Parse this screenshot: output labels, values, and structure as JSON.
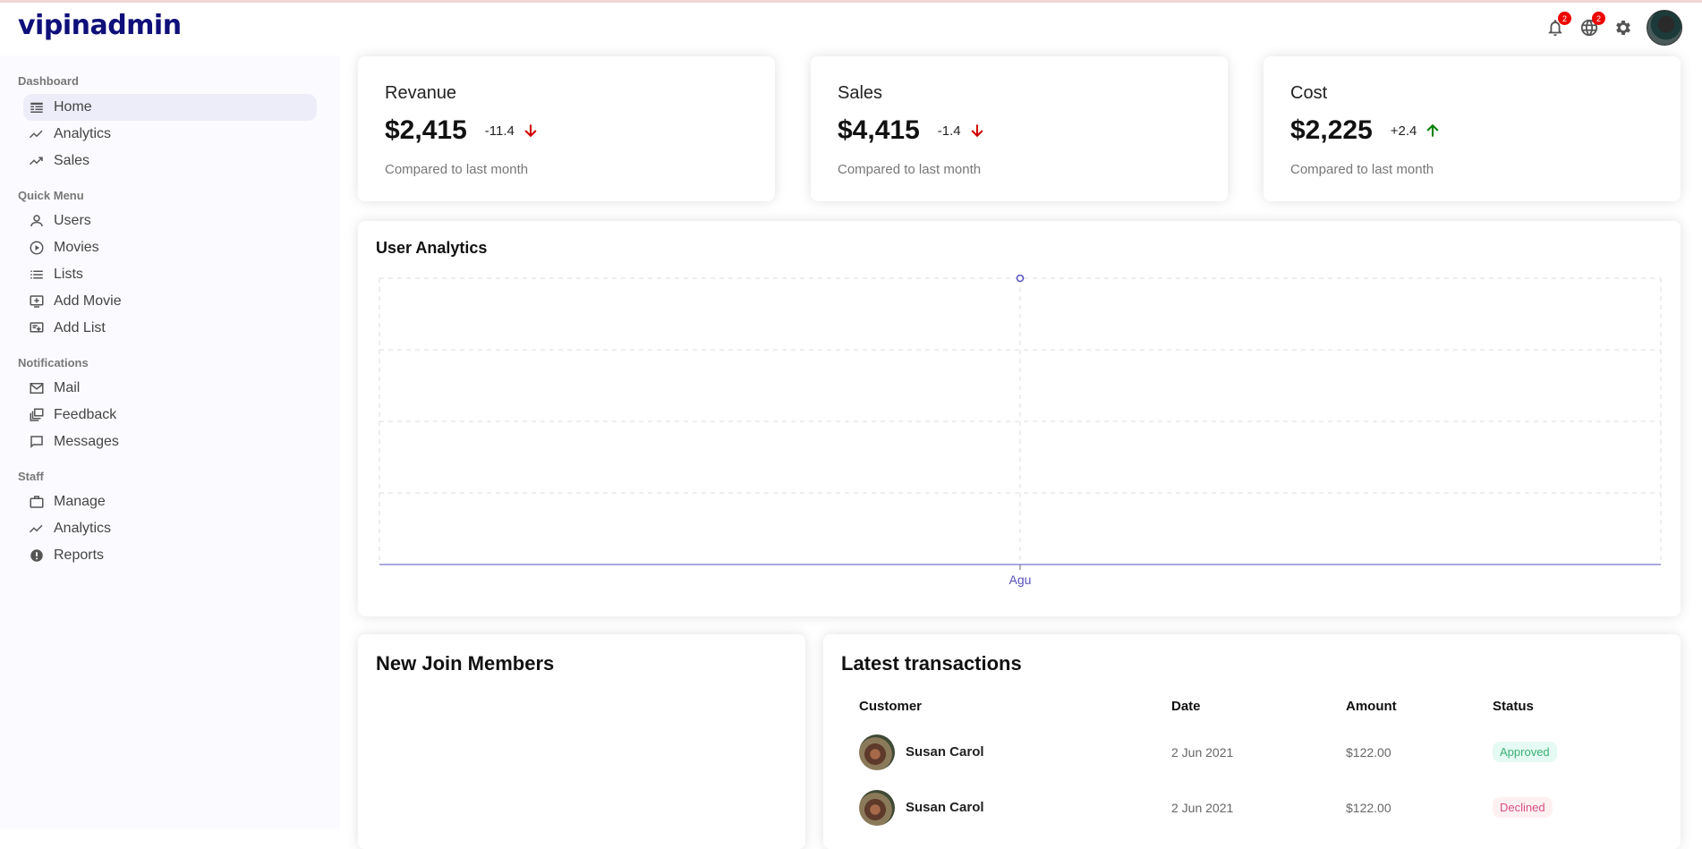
{
  "app": {
    "logo": "vipinadmin"
  },
  "topbar": {
    "notifications_count": "2",
    "language_count": "2"
  },
  "sidebar": {
    "sections": [
      {
        "title": "Dashboard",
        "items": [
          {
            "label": "Home",
            "icon": "dashboard-icon",
            "active": true
          },
          {
            "label": "Analytics",
            "icon": "timeline-icon"
          },
          {
            "label": "Sales",
            "icon": "trending-up-icon"
          }
        ]
      },
      {
        "title": "Quick Menu",
        "items": [
          {
            "label": "Users",
            "icon": "person-icon"
          },
          {
            "label": "Movies",
            "icon": "play-circle-icon"
          },
          {
            "label": "Lists",
            "icon": "list-icon"
          },
          {
            "label": "Add Movie",
            "icon": "add-to-queue-icon"
          },
          {
            "label": "Add List",
            "icon": "playlist-add-icon"
          }
        ]
      },
      {
        "title": "Notifications",
        "items": [
          {
            "label": "Mail",
            "icon": "mail-icon"
          },
          {
            "label": "Feedback",
            "icon": "dynamic-feed-icon"
          },
          {
            "label": "Messages",
            "icon": "chat-bubble-icon"
          }
        ]
      },
      {
        "title": "Staff",
        "items": [
          {
            "label": "Manage",
            "icon": "work-icon"
          },
          {
            "label": "Analytics",
            "icon": "timeline-icon"
          },
          {
            "label": "Reports",
            "icon": "report-icon"
          }
        ]
      }
    ]
  },
  "featured": [
    {
      "title": "Revanue",
      "money": "$2,415",
      "rate": "-11.4",
      "trend": "down",
      "sub": "Compared to last month"
    },
    {
      "title": "Sales",
      "money": "$4,415",
      "rate": "-1.4",
      "trend": "down",
      "sub": "Compared to last month"
    },
    {
      "title": "Cost",
      "money": "$2,225",
      "rate": "+2.4",
      "trend": "up",
      "sub": "Compared to last month"
    }
  ],
  "chart": {
    "title": "User Analytics",
    "chart_data": {
      "type": "line",
      "categories": [
        "Agu"
      ],
      "series": [
        {
          "values": [
            0
          ]
        }
      ],
      "grid": true,
      "line_color": "#5550bd"
    }
  },
  "widgets": {
    "members_title": "New Join Members",
    "transactions_title": "Latest transactions",
    "columns": [
      "Customer",
      "Date",
      "Amount",
      "Status"
    ],
    "rows": [
      {
        "customer": "Susan Carol",
        "date": "2 Jun 2021",
        "amount": "$122.00",
        "status": "Approved"
      },
      {
        "customer": "Susan Carol",
        "date": "2 Jun 2021",
        "amount": "$122.00",
        "status": "Declined"
      }
    ]
  },
  "colors": {
    "brand": "#0f0f7a",
    "down": "#d00000",
    "up": "#008000",
    "badge": "#ee0000"
  }
}
